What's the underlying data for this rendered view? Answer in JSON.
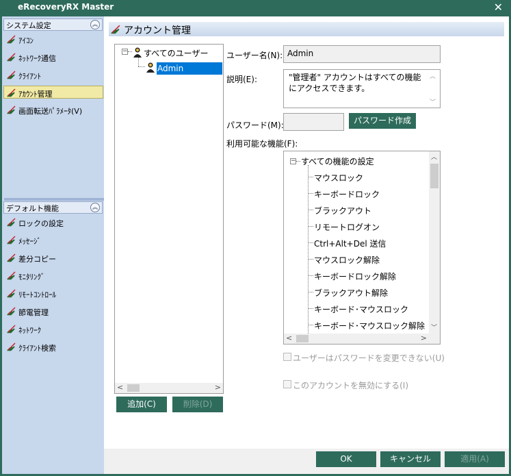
{
  "window": {
    "title": "eRecoveryRX Master",
    "close": "✕"
  },
  "sidebar": {
    "groups": [
      {
        "title": "システム設定",
        "items": [
          {
            "label": "ｱｲｺﾝ"
          },
          {
            "label": "ﾈｯﾄﾜｰｸ通信"
          },
          {
            "label": "ｸﾗｲｱﾝﾄ"
          },
          {
            "label": "ｱｶｳﾝﾄ管理"
          },
          {
            "label": "画面転送ﾊﾟﾗﾒｰﾀ(V)"
          }
        ]
      },
      {
        "title": "デフォルト機能",
        "items": [
          {
            "label": "ロックの設定"
          },
          {
            "label": "ﾒｯｾｰｼﾞ"
          },
          {
            "label": "差分コピー"
          },
          {
            "label": "ﾓﾆﾀﾘﾝｸﾞ"
          },
          {
            "label": "ﾘﾓｰﾄｺﾝﾄﾛｰﾙ"
          },
          {
            "label": "節電管理"
          },
          {
            "label": "ﾈｯﾄﾜｰｸ"
          },
          {
            "label": "ｸﾗｲｱﾝﾄ検索"
          }
        ]
      }
    ],
    "selected": "ｱｶｳﾝﾄ管理"
  },
  "main": {
    "header": "アカウント管理",
    "tree": {
      "root": "すべてのユーザー",
      "child": "Admin"
    },
    "buttons": {
      "add": "追加(C)",
      "delete": "削除(D)"
    },
    "username": {
      "label": "ユーザー名(N):",
      "value": "Admin"
    },
    "description": {
      "label": "説明(E):",
      "value": "\"管理者\" アカウントはすべての機能にアクセスできます。"
    },
    "password": {
      "label": "パスワード(M):",
      "value": "",
      "create_button": "パスワード作成(P)"
    },
    "functions": {
      "label": "利用可能な機能(F):",
      "root": "すべての機能の設定",
      "items": [
        "マウスロック",
        "キーボードロック",
        "ブラックアウト",
        "リモートログオン",
        "Ctrl+Alt+Del 送信",
        "マウスロック解除",
        "キーボードロック解除",
        "ブラックアウト解除",
        "キーボード･マウスロック",
        "キーボード･マウスロック解除"
      ]
    },
    "checks": {
      "no_change_password": "ユーザーはパスワードを変更できない(U)",
      "disable_account": "このアカウントを無効にする(I)"
    }
  },
  "footer": {
    "ok": "OK",
    "cancel": "キャンセル",
    "apply": "適用(A)"
  },
  "colors": {
    "accent": "#2e6b5b",
    "sidebar": "#c7d7ec",
    "selection": "#0078d7",
    "selected_item": "#f1eaa6"
  }
}
